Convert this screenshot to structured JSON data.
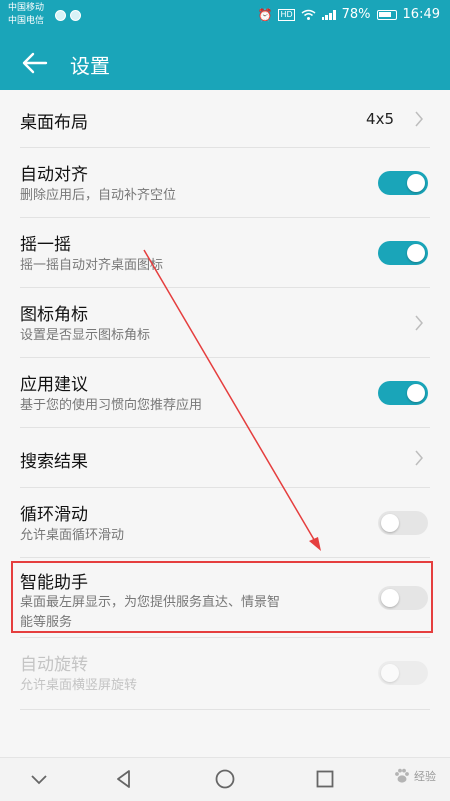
{
  "status_bar": {
    "carrier_1": "中国移动",
    "carrier_2": "中国电信",
    "battery": "78%",
    "time": "16:49",
    "icons": [
      "notification-icon",
      "chat-icon",
      "alarm-icon",
      "hd-icon",
      "wifi-icon",
      "signal-icon",
      "battery-icon"
    ]
  },
  "app_bar": {
    "title": "设置"
  },
  "rows": [
    {
      "title": "桌面布局",
      "value": "4x5",
      "control": "chevron"
    },
    {
      "title": "自动对齐",
      "subtitle": "删除应用后，自动补齐空位",
      "control": "switch",
      "on": true
    },
    {
      "title": "摇一摇",
      "subtitle": "摇一摇自动对齐桌面图标",
      "control": "switch",
      "on": true
    },
    {
      "title": "图标角标",
      "subtitle": "设置是否显示图标角标",
      "control": "chevron"
    },
    {
      "title": "应用建议",
      "subtitle": "基于您的使用习惯向您推荐应用",
      "control": "switch",
      "on": true
    },
    {
      "title": "搜索结果",
      "control": "chevron"
    },
    {
      "title": "循环滑动",
      "subtitle": "允许桌面循环滑动",
      "control": "switch",
      "on": false
    },
    {
      "title": "智能助手",
      "subtitle_line1": "桌面最左屏显示，为您提供服务直达、情景智",
      "subtitle_line2": "能等服务",
      "control": "switch",
      "on": false
    },
    {
      "title": "自动旋转",
      "subtitle": "允许桌面横竖屏旋转",
      "control": "switch",
      "on": false,
      "disabled": true
    }
  ],
  "watermark": {
    "text": "经验"
  },
  "colors": {
    "accent": "#1aa5b9",
    "highlight": "#e53e3e"
  }
}
